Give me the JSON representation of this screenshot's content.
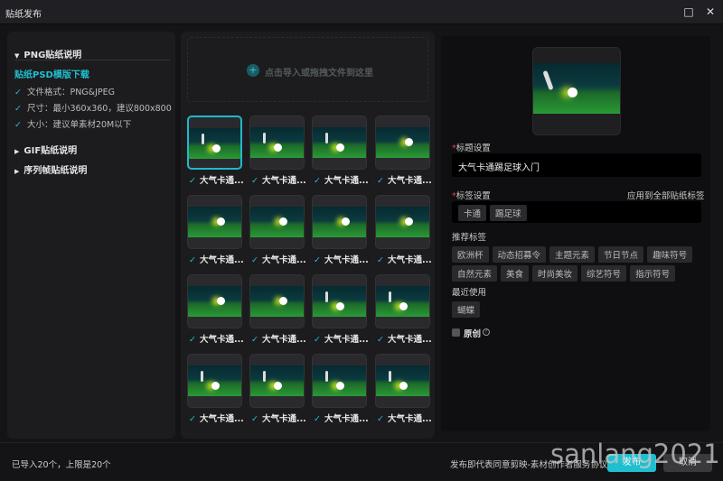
{
  "window": {
    "title": "贴纸发布",
    "minimize_icon": "□",
    "close_icon": "✕"
  },
  "guide": {
    "png_title": "PNG贴纸说明",
    "template_link": "贴纸PSD模版下载",
    "items": [
      "文件格式：PNG&JPEG",
      "尺寸：最小360x360，建议800x800",
      "大小：建议单素材20M以下"
    ],
    "gif_title": "GIF贴纸说明",
    "seq_title": "序列帧贴纸说明"
  },
  "upload": {
    "hint": "点击导入或拖拽文件到这里"
  },
  "stickers": [
    {
      "label": "大气卡通...",
      "v": "kick"
    },
    {
      "label": "大气卡通...",
      "v": "kick"
    },
    {
      "label": "大气卡通...",
      "v": "kick"
    },
    {
      "label": "大气卡通...",
      "v": "ball"
    },
    {
      "label": "大气卡通...",
      "v": "ball"
    },
    {
      "label": "大气卡通...",
      "v": "ball"
    },
    {
      "label": "大气卡通...",
      "v": "ball"
    },
    {
      "label": "大气卡通...",
      "v": "ball"
    },
    {
      "label": "大气卡通...",
      "v": "ball"
    },
    {
      "label": "大气卡通...",
      "v": "ball"
    },
    {
      "label": "大气卡通...",
      "v": "kick"
    },
    {
      "label": "大气卡通...",
      "v": "kick"
    },
    {
      "label": "大气卡通...",
      "v": "kick"
    },
    {
      "label": "大气卡通...",
      "v": "kick"
    },
    {
      "label": "大气卡通...",
      "v": "kick"
    },
    {
      "label": "大气卡通...",
      "v": "kick"
    }
  ],
  "form": {
    "title_label": "标题设置",
    "title_value": "大气卡通踢足球入门",
    "tags_label": "标签设置",
    "apply_all": "应用到全部贴纸标签",
    "tags": [
      "卡通",
      "踢足球"
    ],
    "recommend_label": "推荐标签",
    "recommend": [
      "欧洲杯",
      "动态招募令",
      "主题元素",
      "节日节点",
      "趣味符号",
      "自然元素",
      "美食",
      "时尚美妆",
      "综艺符号",
      "指示符号"
    ],
    "recent_label": "最近使用",
    "recent": [
      "蝴蝶"
    ],
    "original_label": "原创",
    "help_icon": "?"
  },
  "footer": {
    "count": "已导入20个，上限是20个",
    "agreement": "发布即代表同意剪映-素材创作者服务协议",
    "publish": "发布",
    "cancel": "取消"
  },
  "watermark": "sanlang2021",
  "colors": {
    "accent": "#1fbfcf",
    "required": "#e0454a"
  }
}
